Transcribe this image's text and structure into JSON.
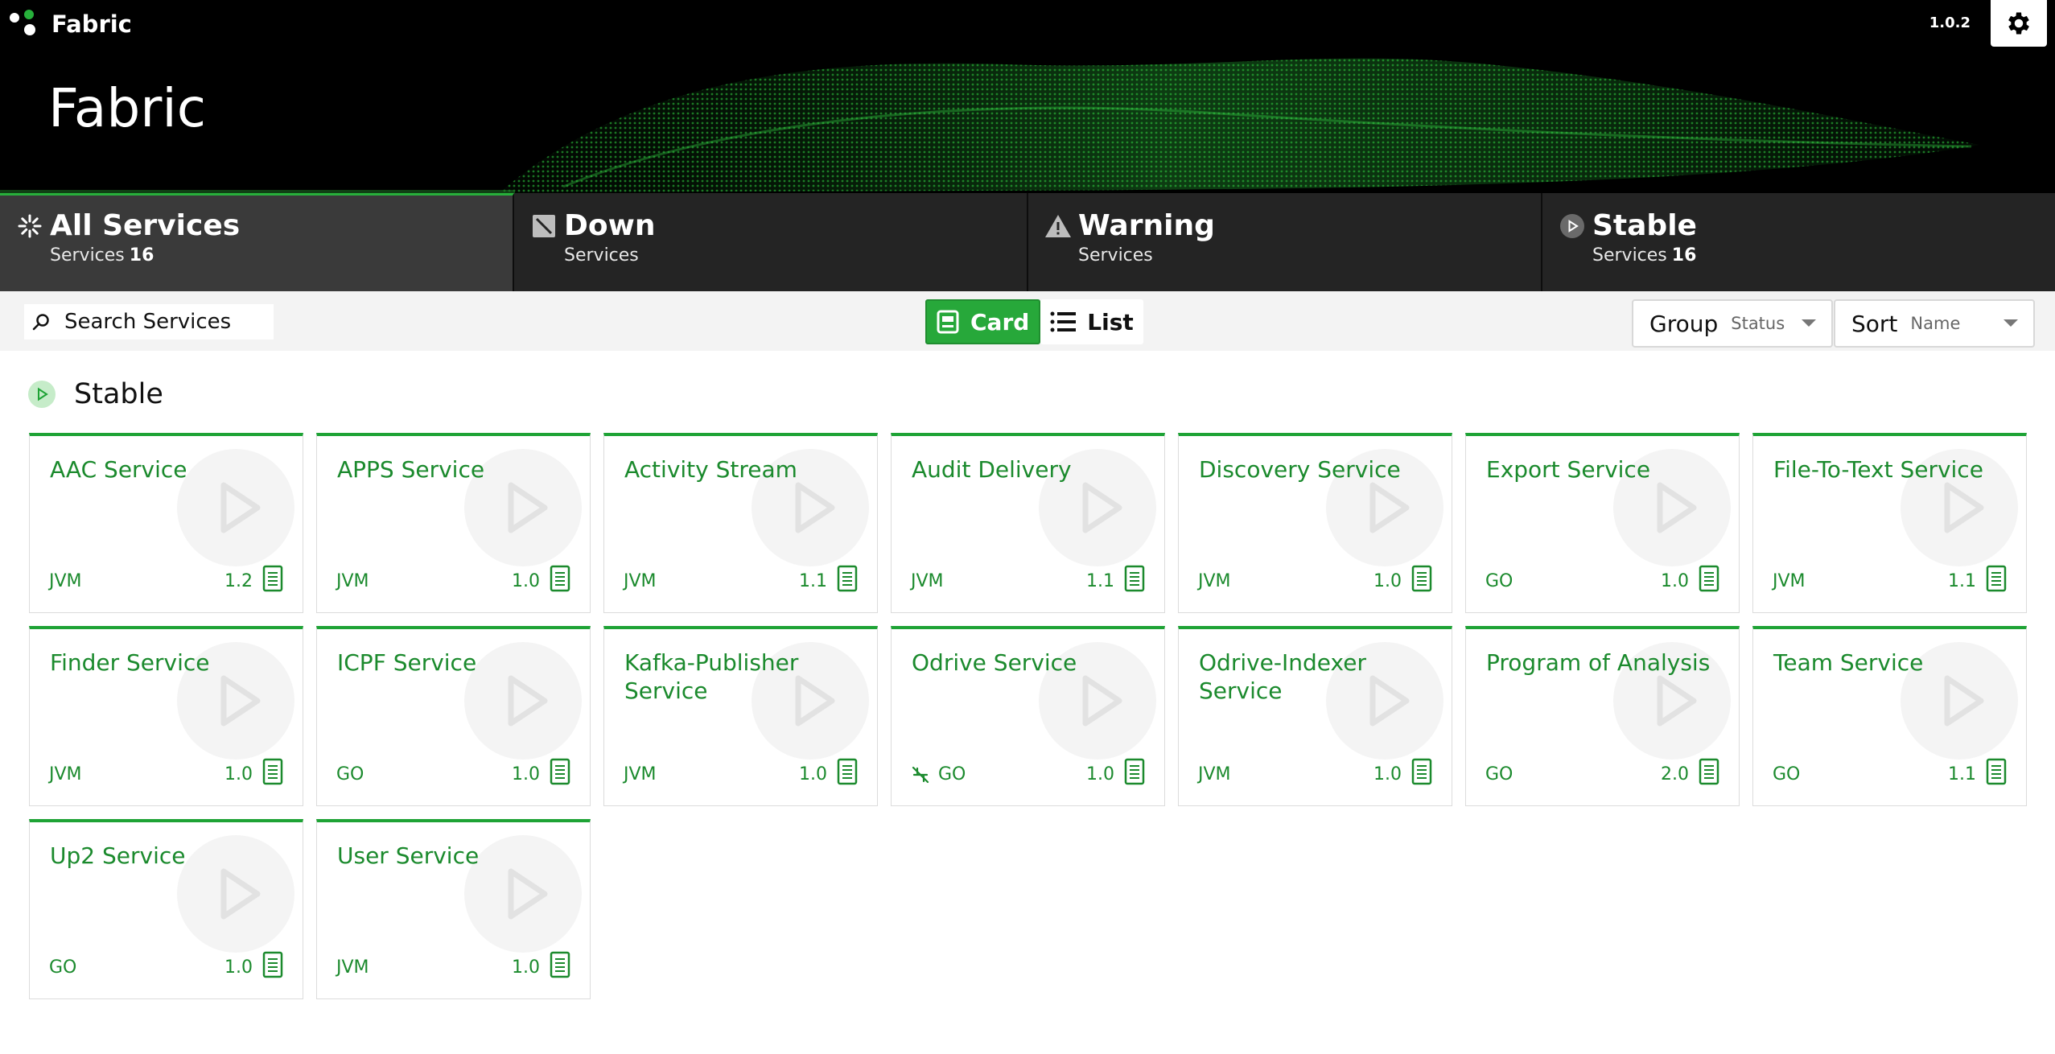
{
  "app": {
    "name": "Fabric",
    "version": "1.0.2"
  },
  "header": {
    "title": "Fabric"
  },
  "icons": {
    "settings": "gear-icon",
    "search": "search-icon",
    "card": "card-view-icon",
    "list": "list-icon"
  },
  "colors": {
    "accent": "#27a83a",
    "text_green": "#1b8a2d",
    "tab_bg": "#242424",
    "tab_active_bg": "#3a3a3a"
  },
  "tabs": [
    {
      "label": "All Services",
      "sub": "Services",
      "count": "16",
      "icon": "loading-spinner-icon"
    },
    {
      "label": "Down",
      "sub": "Services",
      "count": "",
      "icon": "down-icon"
    },
    {
      "label": "Warning",
      "sub": "Services",
      "count": "",
      "icon": "warning-icon"
    },
    {
      "label": "Stable",
      "sub": "Services",
      "count": "16",
      "icon": "play-circle-icon"
    }
  ],
  "toolbar": {
    "search_placeholder": "Search Services",
    "view_card": "Card",
    "view_list": "List",
    "group_label": "Group",
    "group_value": "Status",
    "sort_label": "Sort",
    "sort_value": "Name"
  },
  "section": {
    "title": "Stable"
  },
  "services": [
    {
      "name": "AAC Service",
      "runtime": "JVM",
      "version": "1.2"
    },
    {
      "name": "APPS Service",
      "runtime": "JVM",
      "version": "1.0"
    },
    {
      "name": "Activity Stream",
      "runtime": "JVM",
      "version": "1.1"
    },
    {
      "name": "Audit Delivery",
      "runtime": "JVM",
      "version": "1.1"
    },
    {
      "name": "Discovery Service",
      "runtime": "JVM",
      "version": "1.0"
    },
    {
      "name": "Export Service",
      "runtime": "GO",
      "version": "1.0"
    },
    {
      "name": "File-To-Text Service",
      "runtime": "JVM",
      "version": "1.1"
    },
    {
      "name": "Finder Service",
      "runtime": "JVM",
      "version": "1.0"
    },
    {
      "name": "ICPF Service",
      "runtime": "GO",
      "version": "1.0"
    },
    {
      "name": "Kafka-Publisher Service",
      "runtime": "JVM",
      "version": "1.0"
    },
    {
      "name": "Odrive Service",
      "runtime": "GO",
      "version": "1.0",
      "flag": "not-connected-icon"
    },
    {
      "name": "Odrive-Indexer Service",
      "runtime": "JVM",
      "version": "1.0"
    },
    {
      "name": "Program of Analysis",
      "runtime": "GO",
      "version": "2.0"
    },
    {
      "name": "Team Service",
      "runtime": "GO",
      "version": "1.1"
    },
    {
      "name": "Up2 Service",
      "runtime": "GO",
      "version": "1.0"
    },
    {
      "name": "User Service",
      "runtime": "JVM",
      "version": "1.0"
    }
  ]
}
